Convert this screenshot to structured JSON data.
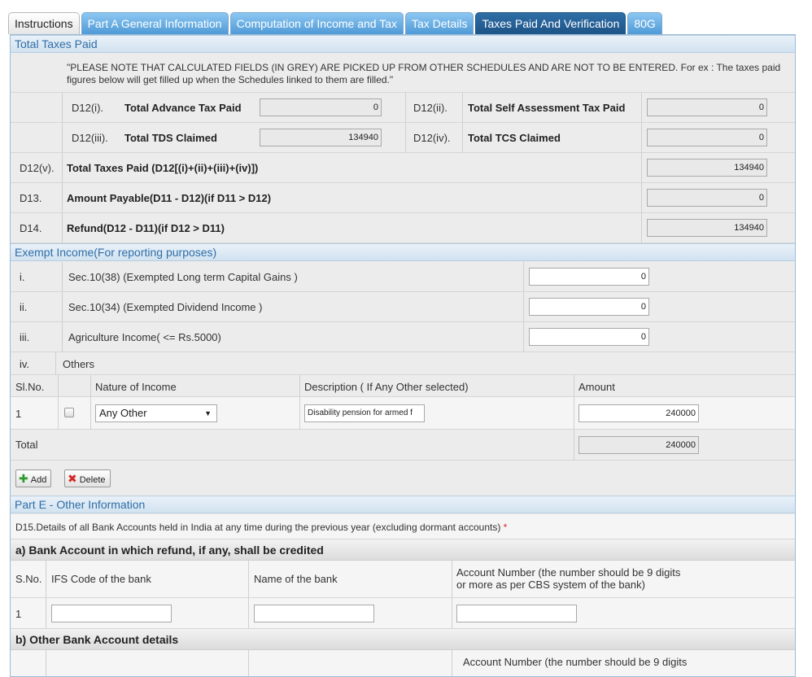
{
  "tabs": [
    {
      "label": "Instructions"
    },
    {
      "label": "Part A General Information"
    },
    {
      "label": "Computation of Income and Tax"
    },
    {
      "label": "Tax Details"
    },
    {
      "label": "Taxes Paid And Verification"
    },
    {
      "label": "80G"
    }
  ],
  "total_taxes": {
    "header": "Total Taxes Paid",
    "note": "\"PLEASE NOTE THAT CALCULATED FIELDS (IN GREY) ARE PICKED UP FROM OTHER SCHEDULES AND ARE NOT TO BE ENTERED. For ex : The taxes paid figures below will get filled up when the Schedules linked to them are filled.\"",
    "d12i": {
      "code": "D12(i).",
      "label": "Total Advance Tax Paid",
      "value": "0"
    },
    "d12ii": {
      "code": "D12(ii).",
      "label": "Total Self Assessment Tax Paid",
      "value": "0"
    },
    "d12iii": {
      "code": "D12(iii).",
      "label": "Total TDS Claimed",
      "value": "134940"
    },
    "d12iv": {
      "code": "D12(iv).",
      "label": "Total TCS Claimed",
      "value": "0"
    },
    "d12v": {
      "code": "D12(v).",
      "label": "Total Taxes Paid (D12[(i)+(ii)+(iii)+(iv)])",
      "value": "134940"
    },
    "d13": {
      "code": "D13.",
      "label": "Amount Payable(D11 - D12)(if D11 > D12)",
      "value": "0"
    },
    "d14": {
      "code": "D14.",
      "label": "Refund(D12 - D11)(if D12 > D11)",
      "value": "134940"
    }
  },
  "exempt": {
    "header": "Exempt Income(For reporting purposes)",
    "i": {
      "code": "i.",
      "label": "Sec.10(38) (Exempted Long term Capital Gains )",
      "value": "0"
    },
    "ii": {
      "code": "ii.",
      "label": "Sec.10(34) (Exempted Dividend Income )",
      "value": "0"
    },
    "iii": {
      "code": "iii.",
      "label": "Agriculture Income( <= Rs.5000)",
      "value": "0"
    },
    "iv": {
      "code": "iv.",
      "label": "Others"
    },
    "cols": {
      "slno": "Sl.No.",
      "nature": "Nature of Income",
      "desc": "Description ( If Any Other selected)",
      "amount": "Amount"
    },
    "row": {
      "slno": "1",
      "nature": "Any Other",
      "desc": "Disability pension for armed f",
      "amount": "240000"
    },
    "total_label": "Total",
    "total_value": "240000",
    "add_label": "Add",
    "delete_label": "Delete"
  },
  "part_e": {
    "header": "Part E - Other Information",
    "d15": "D15.Details of all Bank Accounts held in India at any time during the previous year (excluding dormant accounts)",
    "required_mark": "*",
    "a_title": "a) Bank Account in which refund, if any, shall be credited",
    "cols": {
      "sno": "S.No.",
      "ifs": "IFS Code of the bank",
      "bank": "Name of the bank",
      "acct_line1": "Account Number (the number should be 9 digits",
      "acct_line2": "or more as per CBS system of the bank)"
    },
    "row1": {
      "sno": "1",
      "ifs": "",
      "bank": "",
      "acct": ""
    },
    "b_title": "b) Other Bank Account details",
    "b_acct_partial": "Account Number (the number should be 9 digits"
  }
}
